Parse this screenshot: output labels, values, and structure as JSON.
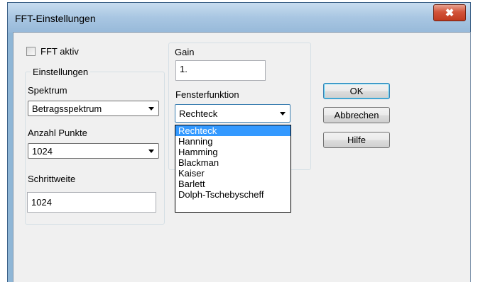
{
  "dialog": {
    "title": "FFT-Einstellungen",
    "close_symbol": "✖"
  },
  "fft_aktiv": {
    "label": "FFT aktiv",
    "checked": false
  },
  "einstellungen": {
    "legend": "Einstellungen",
    "spektrum": {
      "label": "Spektrum",
      "value": "Betragsspektrum"
    },
    "anzahl_punkte": {
      "label": "Anzahl Punkte",
      "value": "1024"
    },
    "schrittweite": {
      "label": "Schrittweite",
      "value": "1024"
    }
  },
  "gain": {
    "label": "Gain",
    "value": "1."
  },
  "fensterfunktion": {
    "label": "Fensterfunktion",
    "value": "Rechteck",
    "options": [
      "Rechteck",
      "Hanning",
      "Hamming",
      "Blackman",
      "Kaiser",
      "Barlett",
      "Dolph-Tschebyscheff"
    ],
    "highlighted_index": 0
  },
  "buttons": {
    "ok": "OK",
    "abbrechen": "Abbrechen",
    "hilfe": "Hilfe"
  }
}
